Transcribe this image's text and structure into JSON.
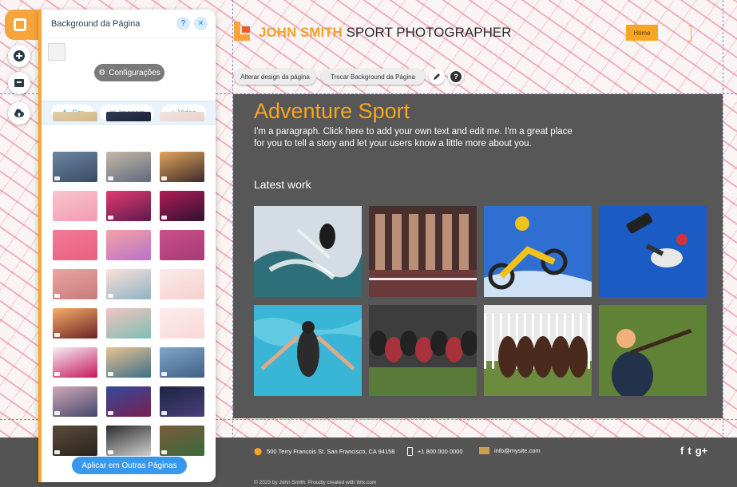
{
  "panel": {
    "title": "Background da Página",
    "help_label": "?",
    "close_label": "×",
    "settings_label": "Configurações",
    "tabs": [
      {
        "label": "Cor",
        "icon": "drop-icon"
      },
      {
        "label": "Imagem",
        "icon": "image-icon"
      },
      {
        "label": "Video",
        "icon": "video-icon"
      }
    ],
    "apply_label": "Aplicar em Outras Páginas",
    "thumbnails": [
      {
        "name": "bg-thumb-partial-tan",
        "colors": [
          "#dfcfa9",
          "#d4b98a"
        ],
        "video": false
      },
      {
        "name": "bg-thumb-partial-navy",
        "colors": [
          "#2f3953",
          "#1c2338"
        ],
        "video": false
      },
      {
        "name": "bg-thumb-partial-pattern",
        "colors": [
          "#f2e4e2",
          "#e8d1cd"
        ],
        "video": false
      },
      {
        "name": "bg-thumb-crowd",
        "colors": [
          "#6c86a3",
          "#3a4a63"
        ],
        "video": true
      },
      {
        "name": "bg-thumb-friends",
        "colors": [
          "#c7b8a8",
          "#5e6a7e"
        ],
        "video": true
      },
      {
        "name": "bg-thumb-sunset",
        "colors": [
          "#e0a55c",
          "#3e2a2a"
        ],
        "video": true
      },
      {
        "name": "bg-thumb-pink-waves",
        "colors": [
          "#f7c6cf",
          "#f39ab0"
        ],
        "video": false
      },
      {
        "name": "bg-thumb-pink-clouds",
        "colors": [
          "#e23b6f",
          "#5e1a4e"
        ],
        "video": true
      },
      {
        "name": "bg-thumb-palm",
        "colors": [
          "#b21c54",
          "#2e1232"
        ],
        "video": true
      },
      {
        "name": "bg-thumb-pink-solid",
        "colors": [
          "#f27a96",
          "#ea5f80"
        ],
        "video": false
      },
      {
        "name": "bg-thumb-gradient",
        "colors": [
          "#f6a1a4",
          "#b873c8"
        ],
        "video": false
      },
      {
        "name": "bg-thumb-polka",
        "colors": [
          "#c9508d",
          "#a53a76"
        ],
        "video": false
      },
      {
        "name": "bg-thumb-blur-pink",
        "colors": [
          "#e9a6a1",
          "#c87a7a"
        ],
        "video": true
      },
      {
        "name": "bg-thumb-flamingo",
        "colors": [
          "#fbe1d9",
          "#8fb3c4"
        ],
        "video": true
      },
      {
        "name": "bg-thumb-dots",
        "colors": [
          "#fbeaea",
          "#f6d0d0"
        ],
        "video": false
      },
      {
        "name": "bg-thumb-hiker",
        "colors": [
          "#f7ae6a",
          "#6b2224"
        ],
        "video": true
      },
      {
        "name": "bg-thumb-flamingos",
        "colors": [
          "#f3c2c2",
          "#7ec0b3"
        ],
        "video": false
      },
      {
        "name": "bg-thumb-hearts",
        "colors": [
          "#fdeced",
          "#f9d7d9"
        ],
        "video": false
      },
      {
        "name": "bg-thumb-ink",
        "colors": [
          "#f5f0f2",
          "#c6165c"
        ],
        "video": true
      },
      {
        "name": "bg-thumb-beach",
        "colors": [
          "#e8c28e",
          "#3d6f8c"
        ],
        "video": true
      },
      {
        "name": "bg-thumb-bubbles",
        "colors": [
          "#7fa7c9",
          "#415f85"
        ],
        "video": true
      },
      {
        "name": "bg-thumb-city",
        "colors": [
          "#d2a9b7",
          "#43466d"
        ],
        "video": true
      },
      {
        "name": "bg-thumb-nebula",
        "colors": [
          "#314b9a",
          "#7a1f4f"
        ],
        "video": true
      },
      {
        "name": "bg-thumb-astronaut",
        "colors": [
          "#1c2341",
          "#4b3f7a"
        ],
        "video": true
      },
      {
        "name": "bg-thumb-tools",
        "colors": [
          "#5a4a3c",
          "#2a231d"
        ],
        "video": true
      },
      {
        "name": "bg-thumb-vinyl",
        "colors": [
          "#2d2d2d",
          "#cfcfcf"
        ],
        "video": true
      },
      {
        "name": "bg-thumb-bowls",
        "colors": [
          "#7a5a3a",
          "#3b6b3c"
        ],
        "video": true
      }
    ]
  },
  "site": {
    "name": "JOHN SMITH",
    "tagline": "SPORT PHOTOGRAPHER",
    "nav_home": "Home"
  },
  "toolbar": {
    "change_design": "Alterar design da página",
    "change_background": "Trocar Background da Página",
    "help_label": "?"
  },
  "content": {
    "title": "Adventure Sport",
    "paragraph": "I'm a paragraph. Click here to add your own text and edit me. I'm a great place for you to tell a story and let your users know a little more about you.",
    "latest_heading": "Latest work",
    "photos": [
      {
        "name": "photo-surfer",
        "subject": "surfer",
        "sky": "#d4dde3",
        "ground": "#2f6f7a",
        "figure": "#1c1c1c"
      },
      {
        "name": "photo-sprinters",
        "subject": "sprinters",
        "sky": "#4a2f2f",
        "ground": "#6a3a3a",
        "figure": "#c79a80"
      },
      {
        "name": "photo-motocross",
        "subject": "motocross",
        "sky": "#2f6fd1",
        "ground": "#cfe1f7",
        "figure": "#f1c21b"
      },
      {
        "name": "photo-skateboarder",
        "subject": "skateboarder",
        "sky": "#1b5cc4",
        "ground": "#3d7ae0",
        "figure": "#e8e8e8"
      },
      {
        "name": "photo-swimmer",
        "subject": "swimmer",
        "sky": "#39b6d6",
        "ground": "#2aa3c7",
        "figure": "#2b2b2b"
      },
      {
        "name": "photo-rugby-scrum",
        "subject": "rugby",
        "sky": "#3d3d3d",
        "ground": "#5a7a3a",
        "figure": "#a8323c"
      },
      {
        "name": "photo-horse-race",
        "subject": "horses",
        "sky": "#e8e8e8",
        "ground": "#6d8b3f",
        "figure": "#4a2a1c"
      },
      {
        "name": "photo-shooter",
        "subject": "shooter",
        "sky": "#6d8f3e",
        "ground": "#4e6e2a",
        "figure": "#f0b27a"
      }
    ]
  },
  "footer": {
    "address": "500 Terry Francois St. San Francisco, CA  94158",
    "phone": "+1 800 000 0000",
    "email": "info@mysite.com",
    "social": [
      "f",
      "t",
      "g+"
    ],
    "copyright": "© 2023 by John Smith. Proudly created with Wix.com"
  }
}
